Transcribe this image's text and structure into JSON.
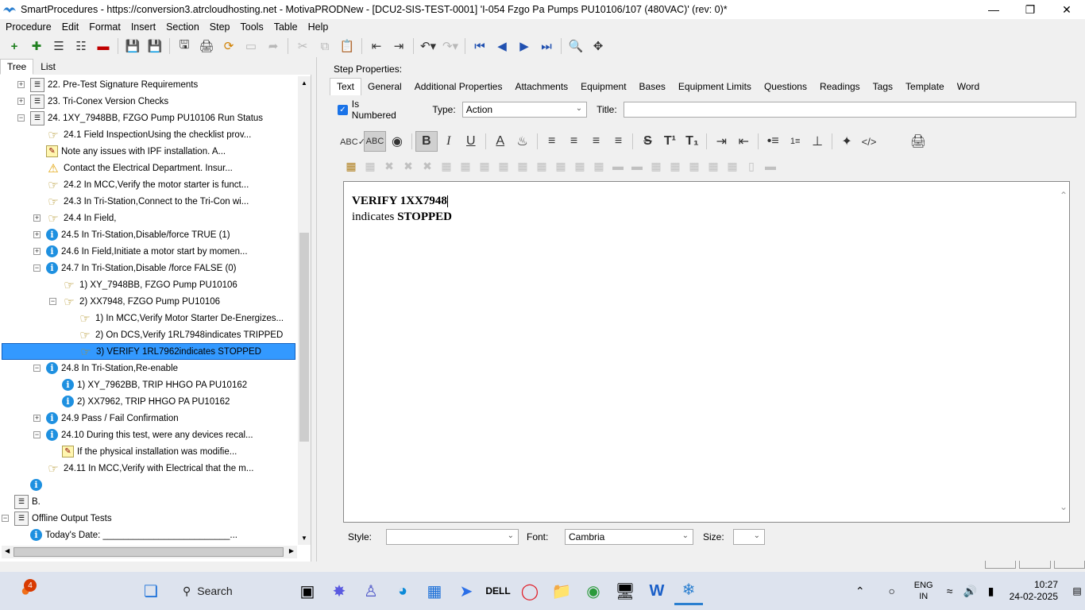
{
  "window": {
    "title": "SmartProcedures - https://conversion3.atrcloudhosting.net - MotivaPRODNew - [DCU2-SIS-TEST-0001] 'I-054 Fzgo Pa Pumps PU10106/107 (480VAC)' (rev: 0)*",
    "min_icon": "minimize-icon",
    "max_icon": "restore-icon",
    "close_icon": "close-icon"
  },
  "menu": [
    "Procedure",
    "Edit",
    "Format",
    "Insert",
    "Section",
    "Step",
    "Tools",
    "Table",
    "Help"
  ],
  "left_tabs": [
    "Tree",
    "List"
  ],
  "tree": [
    {
      "label": "22. Pre-Test Signature Requirements",
      "indent": 0,
      "exp": "+",
      "icon": "doc"
    },
    {
      "label": "23. Tri-Conex Version Checks",
      "indent": 0,
      "exp": "+",
      "icon": "doc"
    },
    {
      "label": "24. 1XY_7948BB, FZGO Pump PU10106 Run Status",
      "indent": 0,
      "exp": "−",
      "icon": "doc"
    },
    {
      "label": "24.1 Field InspectionUsing the checklist prov...",
      "indent": 1,
      "exp": "",
      "icon": "hand"
    },
    {
      "label": "Note any issues with IPF installation. A...",
      "indent": 1,
      "exp": "",
      "icon": "note"
    },
    {
      "label": "Contact the Electrical Department. Insur...",
      "indent": 1,
      "exp": "",
      "icon": "warn"
    },
    {
      "label": "24.2 In MCC,Verify the motor starter is funct...",
      "indent": 1,
      "exp": "",
      "icon": "hand"
    },
    {
      "label": "24.3 In Tri-Station,Connect to the Tri-Con wi...",
      "indent": 1,
      "exp": "",
      "icon": "hand"
    },
    {
      "label": "24.4 In Field,",
      "indent": 1,
      "exp": "+",
      "icon": "hand"
    },
    {
      "label": "24.5 In Tri-Station,Disable/force TRUE (1)",
      "indent": 1,
      "exp": "+",
      "icon": "info"
    },
    {
      "label": "24.6 In Field,Initiate a motor start by momen...",
      "indent": 1,
      "exp": "+",
      "icon": "info"
    },
    {
      "label": "24.7 In Tri-Station,Disable /force FALSE (0)",
      "indent": 1,
      "exp": "−",
      "icon": "info"
    },
    {
      "label": "1) XY_7948BB, FZGO Pump PU10106",
      "indent": 2,
      "exp": "",
      "icon": "hand"
    },
    {
      "label": "2) XX7948, FZGO Pump PU10106",
      "indent": 2,
      "exp": "−",
      "icon": "hand"
    },
    {
      "label": "1) In MCC,Verify Motor Starter De-Energizes...",
      "indent": 3,
      "exp": "",
      "icon": "hand"
    },
    {
      "label": "2) On DCS,Verify 1RL7948indicates TRIPPED",
      "indent": 3,
      "exp": "",
      "icon": "hand"
    },
    {
      "label": "3) VERIFY 1RL7962indicates STOPPED",
      "indent": 3,
      "exp": "",
      "icon": "hand",
      "selected": true
    },
    {
      "label": "24.8 In Tri-Station,Re-enable",
      "indent": 1,
      "exp": "−",
      "icon": "info"
    },
    {
      "label": "1) XY_7962BB, TRIP HHGO PA PU10162",
      "indent": 2,
      "exp": "",
      "icon": "info"
    },
    {
      "label": "2) XX7962, TRIP HHGO PA PU10162",
      "indent": 2,
      "exp": "",
      "icon": "info"
    },
    {
      "label": "24.9 Pass / Fail Confirmation",
      "indent": 1,
      "exp": "+",
      "icon": "info"
    },
    {
      "label": "24.10 During this test, were any devices recal...",
      "indent": 1,
      "exp": "−",
      "icon": "info"
    },
    {
      "label": "If the physical installation was modifie...",
      "indent": 2,
      "exp": "",
      "icon": "note"
    },
    {
      "label": "24.11 In MCC,Verify with Electrical that the m...",
      "indent": 1,
      "exp": "",
      "icon": "hand"
    },
    {
      "label": "",
      "indent": 0,
      "exp": "",
      "icon": "info"
    },
    {
      "label": "B.",
      "indent": -1,
      "exp": "",
      "icon": "doc"
    },
    {
      "label": "Offline Output Tests",
      "indent": -1,
      "exp": "−",
      "icon": "doc"
    },
    {
      "label": "Today's Date: _________________________...",
      "indent": 0,
      "exp": "",
      "icon": "info"
    }
  ],
  "step": {
    "header": "Step Properties:",
    "tabs": [
      "Text",
      "General",
      "Additional Properties",
      "Attachments",
      "Equipment",
      "Bases",
      "Equipment Limits",
      "Questions",
      "Readings",
      "Tags",
      "Template",
      "Word"
    ],
    "is_numbered_label": "Is Numbered",
    "type_label": "Type:",
    "type_value": "Action",
    "title_label": "Title:",
    "title_value": ""
  },
  "editor": {
    "line1": "VERIFY 1XX7948",
    "line2_prefix": "indicates ",
    "line2_bold": "STOPPED"
  },
  "bottom": {
    "style_label": "Style:",
    "style_value": "",
    "font_label": "Font:",
    "font_value": "Cambria",
    "size_label": "Size:",
    "size_value": ""
  },
  "taskbar": {
    "search_label": "Search",
    "notif_count": "4",
    "lang_line1": "ENG",
    "lang_line2": "IN",
    "time": "10:27",
    "date": "24-02-2025"
  }
}
